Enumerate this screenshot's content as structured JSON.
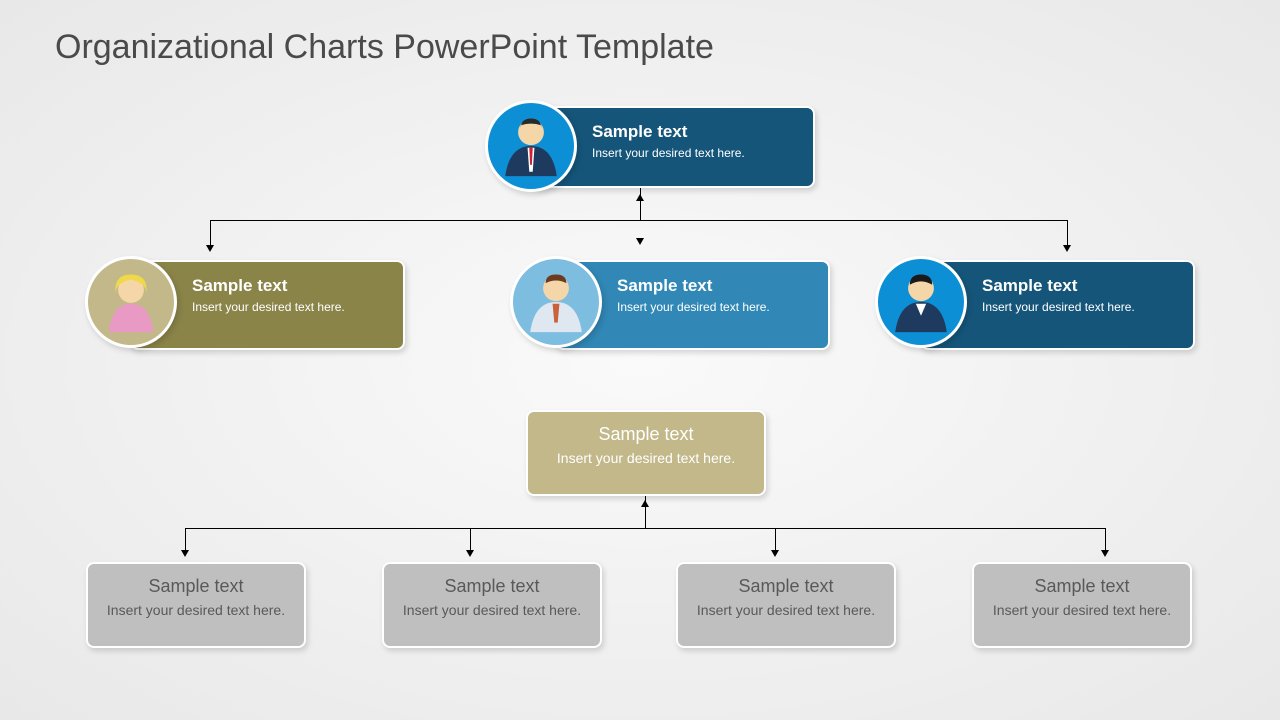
{
  "title": "Organizational Charts PowerPoint Template",
  "top": {
    "title": "Sample text",
    "sub": "Insert your desired text here."
  },
  "mid": [
    {
      "title": "Sample text",
      "sub": "Insert your desired text here."
    },
    {
      "title": "Sample text",
      "sub": "Insert your desired text here."
    },
    {
      "title": "Sample text",
      "sub": "Insert your desired text here."
    }
  ],
  "subhead": {
    "title": "Sample text",
    "sub": "Insert your desired text here."
  },
  "bottom": [
    {
      "title": "Sample text",
      "sub": "Insert your desired text here."
    },
    {
      "title": "Sample text",
      "sub": "Insert your desired text here."
    },
    {
      "title": "Sample text",
      "sub": "Insert your desired text here."
    },
    {
      "title": "Sample text",
      "sub": "Insert your desired text here."
    }
  ],
  "colors": {
    "topCard": "#15557a",
    "topAvatar": "#0d8fd6",
    "mid0Card": "#8a8449",
    "mid0Avatar": "#c3b88a",
    "mid1Card": "#3187b5",
    "mid1Avatar": "#7dbde0",
    "mid2Card": "#15557a",
    "mid2Avatar": "#0d8fd6",
    "subheadBg": "#c3b88a",
    "subheadText": "#ffffff",
    "bottomBg": "#bfbfbf",
    "bottomText": "#595959"
  }
}
